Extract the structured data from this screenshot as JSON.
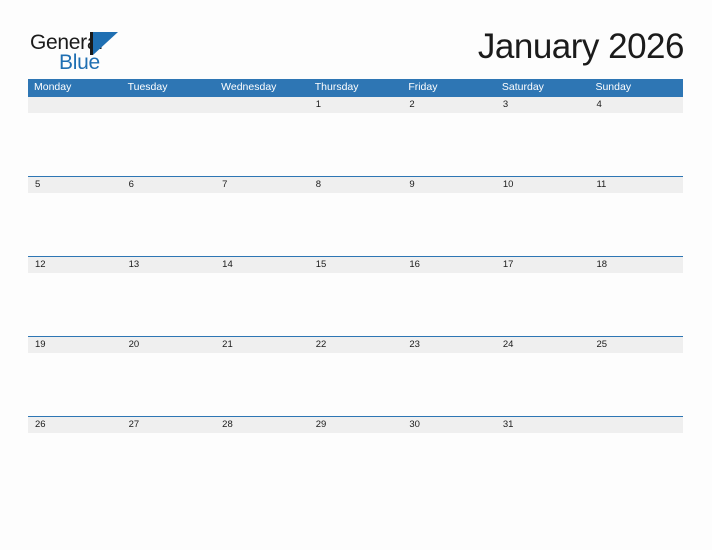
{
  "brand": {
    "name_part1": "General",
    "name_part2": "Blue",
    "accent_color": "#1f6fb2",
    "mark_icon": "triangle-logo-icon"
  },
  "header": {
    "title": "January 2026"
  },
  "calendar": {
    "month": "January",
    "year": "2026",
    "header_bg_color": "#2e76b4",
    "date_band_color": "#efefef",
    "rule_color": "#2e76b4",
    "weekdays": [
      "Monday",
      "Tuesday",
      "Wednesday",
      "Thursday",
      "Friday",
      "Saturday",
      "Sunday"
    ],
    "weeks": [
      [
        "",
        "",
        "",
        "1",
        "2",
        "3",
        "4"
      ],
      [
        "5",
        "6",
        "7",
        "8",
        "9",
        "10",
        "11"
      ],
      [
        "12",
        "13",
        "14",
        "15",
        "16",
        "17",
        "18"
      ],
      [
        "19",
        "20",
        "21",
        "22",
        "23",
        "24",
        "25"
      ],
      [
        "26",
        "27",
        "28",
        "29",
        "30",
        "31",
        ""
      ]
    ]
  }
}
